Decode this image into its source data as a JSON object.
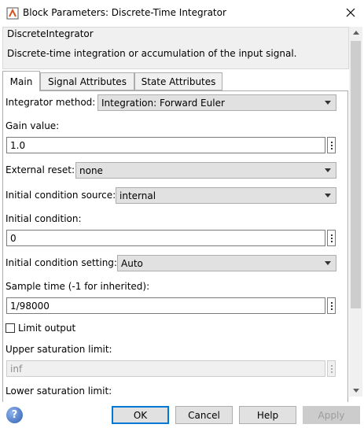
{
  "window": {
    "title": "Block Parameters: Discrete-Time Integrator"
  },
  "block": {
    "type": "DiscreteIntegrator",
    "description": "Discrete-time integration or accumulation of the input signal."
  },
  "tabs": [
    {
      "label": "Main",
      "active": true
    },
    {
      "label": "Signal Attributes",
      "active": false
    },
    {
      "label": "State Attributes",
      "active": false
    }
  ],
  "params": {
    "integrator_method": {
      "label": "Integrator method:",
      "value": "Integration: Forward Euler"
    },
    "gain_value": {
      "label": "Gain value:",
      "value": "1.0"
    },
    "external_reset": {
      "label": "External reset:",
      "value": "none"
    },
    "ic_source": {
      "label": "Initial condition source:",
      "value": "internal"
    },
    "initial_condition": {
      "label": "Initial condition:",
      "value": "0"
    },
    "ic_setting": {
      "label": "Initial condition setting:",
      "value": "Auto"
    },
    "sample_time": {
      "label": "Sample time (-1 for inherited):",
      "value": "1/98000"
    },
    "limit_output": {
      "label": "Limit output",
      "checked": false
    },
    "upper_limit": {
      "label": "Upper saturation limit:",
      "value": "inf",
      "enabled": false
    },
    "lower_limit": {
      "label": "Lower saturation limit:"
    }
  },
  "buttons": {
    "ok": "OK",
    "cancel": "Cancel",
    "help": "Help",
    "apply": "Apply"
  },
  "icons": {
    "help": "?"
  },
  "colors": {
    "default_button_border": "#0078d7",
    "panel_bg": "#f0f0f0"
  }
}
